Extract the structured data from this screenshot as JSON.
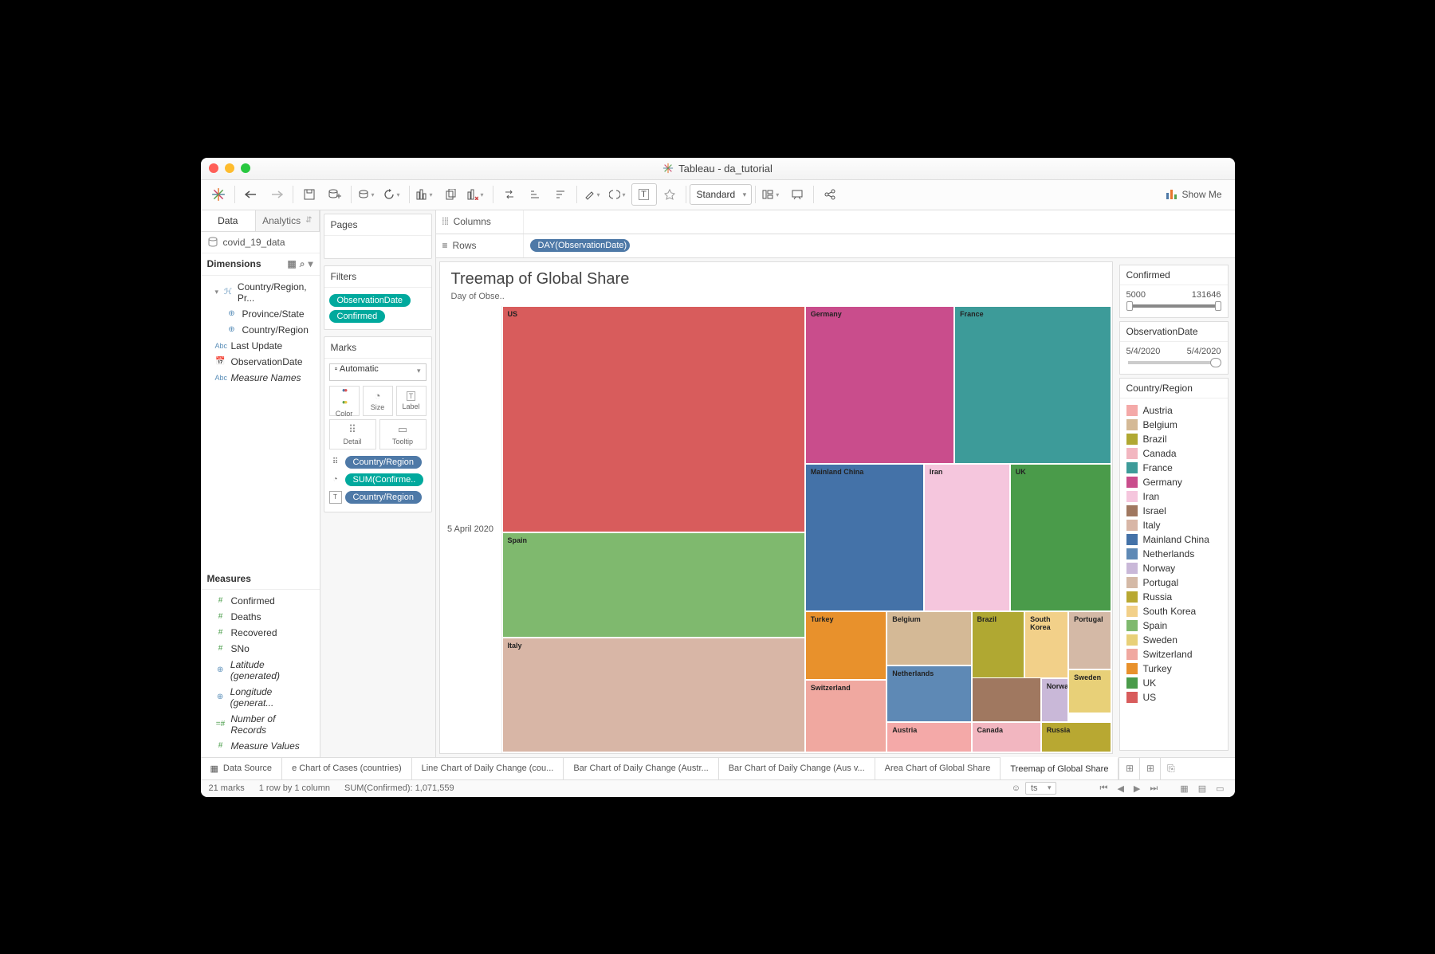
{
  "window_title": "Tableau - da_tutorial",
  "toolbar": {
    "fit_mode": "Standard",
    "showme": "Show Me"
  },
  "left": {
    "tab_data": "Data",
    "tab_analytics": "Analytics",
    "datasource": "covid_19_data",
    "dimensions_label": "Dimensions",
    "dimensions": {
      "hierarchy": "Country/Region, Pr...",
      "province": "Province/State",
      "country": "Country/Region",
      "last_update": "Last Update",
      "obs_date": "ObservationDate",
      "measure_names": "Measure Names"
    },
    "measures_label": "Measures",
    "measures": {
      "confirmed": "Confirmed",
      "deaths": "Deaths",
      "recovered": "Recovered",
      "sno": "SNo",
      "lat": "Latitude (generated)",
      "lon": "Longitude (generat...",
      "nrec": "Number of Records",
      "mvals": "Measure Values"
    }
  },
  "cards": {
    "pages": "Pages",
    "filters": "Filters",
    "filter_pills": {
      "obs": "ObservationDate",
      "conf": "Confirmed"
    },
    "marks": "Marks",
    "mark_type": "Automatic",
    "color": "Color",
    "size": "Size",
    "label": "Label",
    "detail": "Detail",
    "tooltip": "Tooltip",
    "mark_pills": {
      "p1": "Country/Region",
      "p2": "SUM(Confirme..",
      "p3": "Country/Region"
    }
  },
  "shelves": {
    "columns": "Columns",
    "rows": "Rows",
    "row_pill": "DAY(ObservationDate)"
  },
  "viz": {
    "title": "Treemap of Global Share",
    "subtitle": "Day of Obse..",
    "axis_label": "5 April 2020"
  },
  "right": {
    "confirmed": "Confirmed",
    "conf_min": "5000",
    "conf_max": "131646",
    "obs": "ObservationDate",
    "obs_from": "5/4/2020",
    "obs_to": "5/4/2020",
    "legend_title": "Country/Region"
  },
  "legend": [
    {
      "name": "Austria",
      "color": "#f4a9a8"
    },
    {
      "name": "Belgium",
      "color": "#d4b996"
    },
    {
      "name": "Brazil",
      "color": "#b0a832"
    },
    {
      "name": "Canada",
      "color": "#f2b6c0"
    },
    {
      "name": "France",
      "color": "#3d9b99"
    },
    {
      "name": "Germany",
      "color": "#c94d8c"
    },
    {
      "name": "Iran",
      "color": "#f5c6dd"
    },
    {
      "name": "Israel",
      "color": "#a07860"
    },
    {
      "name": "Italy",
      "color": "#d8b6a6"
    },
    {
      "name": "Mainland China",
      "color": "#4472a8"
    },
    {
      "name": "Netherlands",
      "color": "#5e89b5"
    },
    {
      "name": "Norway",
      "color": "#c9b8d8"
    },
    {
      "name": "Portugal",
      "color": "#d4b9a6"
    },
    {
      "name": "Russia",
      "color": "#b8a832"
    },
    {
      "name": "South Korea",
      "color": "#f2d089"
    },
    {
      "name": "Spain",
      "color": "#7fb96e"
    },
    {
      "name": "Sweden",
      "color": "#e8d078"
    },
    {
      "name": "Switzerland",
      "color": "#f0a8a0"
    },
    {
      "name": "Turkey",
      "color": "#e8912c"
    },
    {
      "name": "UK",
      "color": "#4a9b4a"
    },
    {
      "name": "US",
      "color": "#d85c5c"
    }
  ],
  "chart_data": {
    "type": "treemap",
    "title": "Treemap of Global Share",
    "date": "5 April 2020",
    "value_field": "Confirmed",
    "items": [
      {
        "name": "US",
        "value": 337072,
        "color": "#d85c5c"
      },
      {
        "name": "Spain",
        "value": 131646,
        "color": "#7fb96e"
      },
      {
        "name": "Italy",
        "value": 128948,
        "color": "#d8b6a6"
      },
      {
        "name": "Germany",
        "value": 100123,
        "color": "#c94d8c"
      },
      {
        "name": "France",
        "value": 93773,
        "color": "#3d9b99"
      },
      {
        "name": "Mainland China",
        "value": 82602,
        "color": "#4472a8"
      },
      {
        "name": "Iran",
        "value": 58226,
        "color": "#f5c6dd"
      },
      {
        "name": "UK",
        "value": 48436,
        "color": "#4a9b4a"
      },
      {
        "name": "Turkey",
        "value": 27069,
        "color": "#e8912c"
      },
      {
        "name": "Switzerland",
        "value": 21100,
        "color": "#f0a8a0"
      },
      {
        "name": "Belgium",
        "value": 19691,
        "color": "#d4b996"
      },
      {
        "name": "Netherlands",
        "value": 17953,
        "color": "#5e89b5"
      },
      {
        "name": "Austria",
        "value": 12051,
        "color": "#f4a9a8"
      },
      {
        "name": "Canada",
        "value": 15756,
        "color": "#f2b6c0"
      },
      {
        "name": "Brazil",
        "value": 11130,
        "color": "#b0a832"
      },
      {
        "name": "Israel",
        "value": 8430,
        "color": "#a07860"
      },
      {
        "name": "South Korea",
        "value": 10237,
        "color": "#f2d089"
      },
      {
        "name": "Russia",
        "value": 5389,
        "color": "#b8a832"
      },
      {
        "name": "Portugal",
        "value": 11278,
        "color": "#d4b9a6"
      },
      {
        "name": "Sweden",
        "value": 6830,
        "color": "#e8d078"
      },
      {
        "name": "Norway",
        "value": 5687,
        "color": "#c9b8d8"
      }
    ]
  },
  "tabs": [
    "Data Source",
    "e Chart of Cases (countries)",
    "Line Chart of Daily Change (cou...",
    "Bar Chart of Daily Change (Austr...",
    "Bar Chart of Daily Change (Aus v...",
    "Area Chart of Global Share",
    "Treemap of Global Share"
  ],
  "status": {
    "marks": "21 marks",
    "rc": "1 row by 1 column",
    "sum": "SUM(Confirmed): 1,071,559",
    "user": "ts"
  }
}
